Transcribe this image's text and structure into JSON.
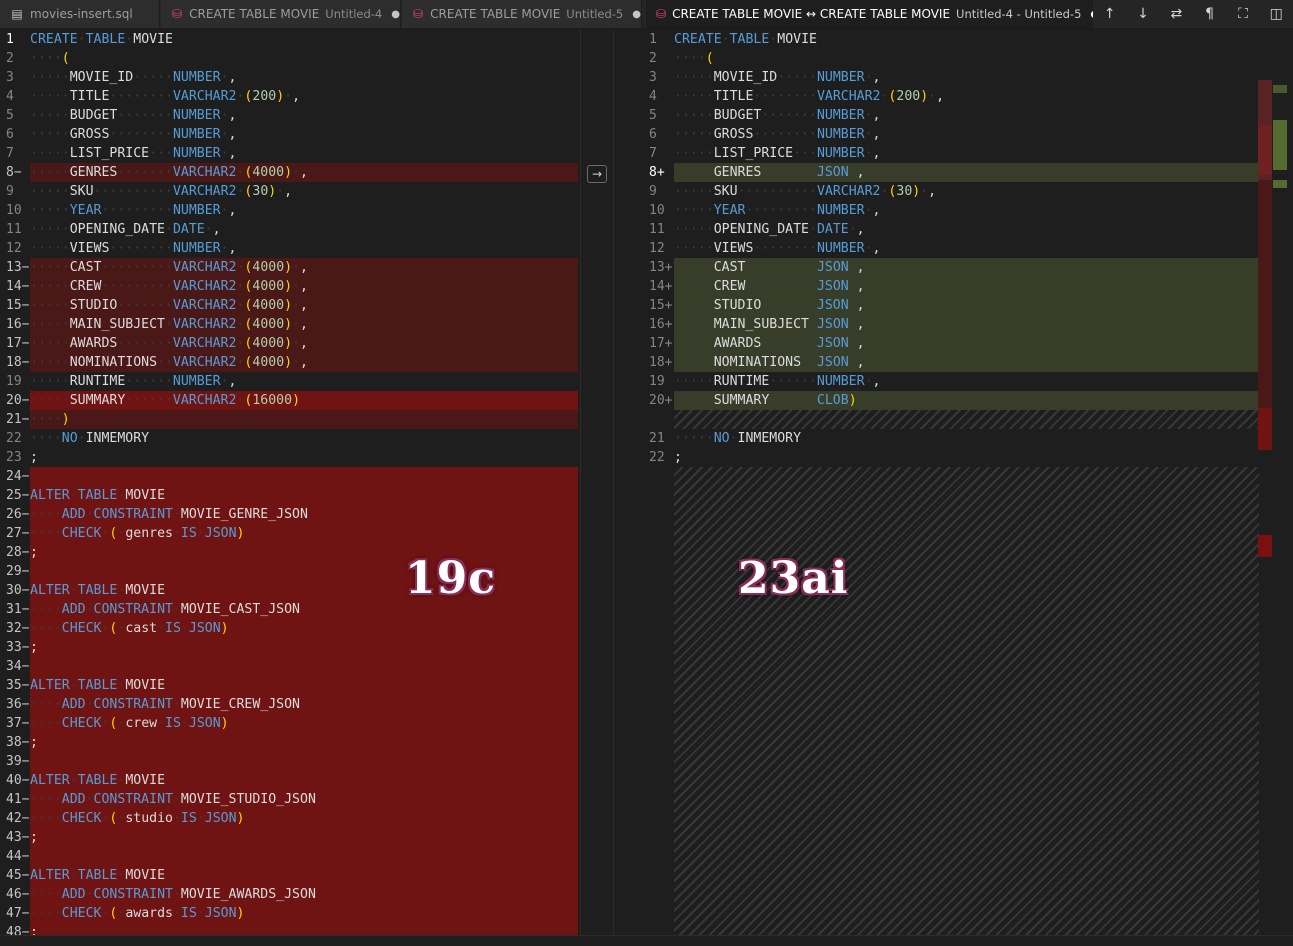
{
  "tabs": [
    {
      "icon": "file-icon",
      "title": "movies-insert.sql",
      "desc": "",
      "dot": false,
      "active": false
    },
    {
      "icon": "database-icon",
      "title": "CREATE TABLE MOVIE",
      "desc": "Untitled-4",
      "dot": true,
      "active": false
    },
    {
      "icon": "database-icon",
      "title": "CREATE TABLE MOVIE",
      "desc": "Untitled-5",
      "dot": true,
      "active": false
    },
    {
      "icon": "database-icon",
      "title": "CREATE TABLE MOVIE ↔ CREATE TABLE MOVIE",
      "desc": "Untitled-4 - Untitled-5",
      "dot": true,
      "active": true
    }
  ],
  "toolbar": {
    "prev_change": "↑",
    "next_change": "↓",
    "swap": "⇄",
    "whitespace": "¶",
    "map": "⛶",
    "split": "◫"
  },
  "overlay_labels": {
    "left": "19c",
    "right": "23ai"
  },
  "left_lines": [
    {
      "n": "1",
      "m": "",
      "hl": "",
      "t": "CREATE TABLE MOVIE"
    },
    {
      "n": "2",
      "m": "",
      "hl": "",
      "t": "    ("
    },
    {
      "n": "3",
      "m": "",
      "hl": "",
      "t": "     MOVIE_ID     NUMBER ,"
    },
    {
      "n": "4",
      "m": "",
      "hl": "",
      "t": "     TITLE        VARCHAR2 (200) ,"
    },
    {
      "n": "5",
      "m": "",
      "hl": "",
      "t": "     BUDGET       NUMBER ,"
    },
    {
      "n": "6",
      "m": "",
      "hl": "",
      "t": "     GROSS        NUMBER ,"
    },
    {
      "n": "7",
      "m": "",
      "hl": "",
      "t": "     LIST_PRICE   NUMBER ,"
    },
    {
      "n": "8",
      "m": "−",
      "hl": "del",
      "t": "     GENRES       VARCHAR2 (4000) ,"
    },
    {
      "n": "9",
      "m": "",
      "hl": "",
      "t": "     SKU          VARCHAR2 (30) ,"
    },
    {
      "n": "10",
      "m": "",
      "hl": "",
      "t": "     YEAR         NUMBER ,"
    },
    {
      "n": "11",
      "m": "",
      "hl": "",
      "t": "     OPENING_DATE DATE ,"
    },
    {
      "n": "12",
      "m": "",
      "hl": "",
      "t": "     VIEWS        NUMBER ,"
    },
    {
      "n": "13",
      "m": "−",
      "hl": "del",
      "t": "     CAST         VARCHAR2 (4000) ,"
    },
    {
      "n": "14",
      "m": "−",
      "hl": "del",
      "t": "     CREW         VARCHAR2 (4000) ,"
    },
    {
      "n": "15",
      "m": "−",
      "hl": "del",
      "t": "     STUDIO       VARCHAR2 (4000) ,"
    },
    {
      "n": "16",
      "m": "−",
      "hl": "del",
      "t": "     MAIN_SUBJECT VARCHAR2 (4000) ,"
    },
    {
      "n": "17",
      "m": "−",
      "hl": "del",
      "t": "     AWARDS       VARCHAR2 (4000) ,"
    },
    {
      "n": "18",
      "m": "−",
      "hl": "del",
      "t": "     NOMINATIONS  VARCHAR2 (4000) ,"
    },
    {
      "n": "19",
      "m": "",
      "hl": "",
      "t": "     RUNTIME      NUMBER ,"
    },
    {
      "n": "20",
      "m": "−",
      "hl": "delstrong",
      "t": "     SUMMARY      VARCHAR2 (16000)"
    },
    {
      "n": "21",
      "m": "−",
      "hl": "del",
      "t": "    )"
    },
    {
      "n": "22",
      "m": "",
      "hl": "",
      "t": "    NO INMEMORY"
    },
    {
      "n": "23",
      "m": "",
      "hl": "",
      "t": ";"
    },
    {
      "n": "24",
      "m": "−",
      "hl": "delstrong",
      "t": ""
    },
    {
      "n": "25",
      "m": "−",
      "hl": "delstrong",
      "t": "ALTER TABLE MOVIE"
    },
    {
      "n": "26",
      "m": "−",
      "hl": "delstrong",
      "t": "    ADD CONSTRAINT MOVIE_GENRE_JSON"
    },
    {
      "n": "27",
      "m": "−",
      "hl": "delstrong",
      "t": "    CHECK ( genres IS JSON)"
    },
    {
      "n": "28",
      "m": "−",
      "hl": "delstrong",
      "t": ";"
    },
    {
      "n": "29",
      "m": "−",
      "hl": "delstrong",
      "t": ""
    },
    {
      "n": "30",
      "m": "−",
      "hl": "delstrong",
      "t": "ALTER TABLE MOVIE"
    },
    {
      "n": "31",
      "m": "−",
      "hl": "delstrong",
      "t": "    ADD CONSTRAINT MOVIE_CAST_JSON"
    },
    {
      "n": "32",
      "m": "−",
      "hl": "delstrong",
      "t": "    CHECK ( cast IS JSON)"
    },
    {
      "n": "33",
      "m": "−",
      "hl": "delstrong",
      "t": ";"
    },
    {
      "n": "34",
      "m": "−",
      "hl": "delstrong",
      "t": ""
    },
    {
      "n": "35",
      "m": "−",
      "hl": "delstrong",
      "t": "ALTER TABLE MOVIE"
    },
    {
      "n": "36",
      "m": "−",
      "hl": "delstrong",
      "t": "    ADD CONSTRAINT MOVIE_CREW_JSON"
    },
    {
      "n": "37",
      "m": "−",
      "hl": "delstrong",
      "t": "    CHECK ( crew IS JSON)"
    },
    {
      "n": "38",
      "m": "−",
      "hl": "delstrong",
      "t": ";"
    },
    {
      "n": "39",
      "m": "−",
      "hl": "delstrong",
      "t": ""
    },
    {
      "n": "40",
      "m": "−",
      "hl": "delstrong",
      "t": "ALTER TABLE MOVIE"
    },
    {
      "n": "41",
      "m": "−",
      "hl": "delstrong",
      "t": "    ADD CONSTRAINT MOVIE_STUDIO_JSON"
    },
    {
      "n": "42",
      "m": "−",
      "hl": "delstrong",
      "t": "    CHECK ( studio IS JSON)"
    },
    {
      "n": "43",
      "m": "−",
      "hl": "delstrong",
      "t": ";"
    },
    {
      "n": "44",
      "m": "−",
      "hl": "delstrong",
      "t": ""
    },
    {
      "n": "45",
      "m": "−",
      "hl": "delstrong",
      "t": "ALTER TABLE MOVIE"
    },
    {
      "n": "46",
      "m": "−",
      "hl": "delstrong",
      "t": "    ADD CONSTRAINT MOVIE_AWARDS_JSON"
    },
    {
      "n": "47",
      "m": "−",
      "hl": "delstrong",
      "t": "    CHECK ( awards IS JSON)"
    },
    {
      "n": "48",
      "m": "−",
      "hl": "delstrong",
      "t": ";"
    }
  ],
  "right_lines": [
    {
      "n": "1",
      "m": "",
      "hl": "",
      "t": "CREATE TABLE MOVIE"
    },
    {
      "n": "2",
      "m": "",
      "hl": "",
      "t": "    ("
    },
    {
      "n": "3",
      "m": "",
      "hl": "",
      "t": "     MOVIE_ID     NUMBER ,"
    },
    {
      "n": "4",
      "m": "",
      "hl": "",
      "t": "     TITLE        VARCHAR2 (200) ,"
    },
    {
      "n": "5",
      "m": "",
      "hl": "",
      "t": "     BUDGET       NUMBER ,"
    },
    {
      "n": "6",
      "m": "",
      "hl": "",
      "t": "     GROSS        NUMBER ,"
    },
    {
      "n": "7",
      "m": "",
      "hl": "",
      "t": "     LIST_PRICE   NUMBER ,"
    },
    {
      "n": "8",
      "m": "+",
      "hl": "ins",
      "t": "     GENRES       JSON ,"
    },
    {
      "n": "9",
      "m": "",
      "hl": "",
      "t": "     SKU          VARCHAR2 (30) ,"
    },
    {
      "n": "10",
      "m": "",
      "hl": "",
      "t": "     YEAR         NUMBER ,"
    },
    {
      "n": "11",
      "m": "",
      "hl": "",
      "t": "     OPENING_DATE DATE ,"
    },
    {
      "n": "12",
      "m": "",
      "hl": "",
      "t": "     VIEWS        NUMBER ,"
    },
    {
      "n": "13",
      "m": "+",
      "hl": "ins",
      "t": "     CAST         JSON ,"
    },
    {
      "n": "14",
      "m": "+",
      "hl": "ins",
      "t": "     CREW         JSON ,"
    },
    {
      "n": "15",
      "m": "+",
      "hl": "ins",
      "t": "     STUDIO       JSON ,"
    },
    {
      "n": "16",
      "m": "+",
      "hl": "ins",
      "t": "     MAIN_SUBJECT JSON ,"
    },
    {
      "n": "17",
      "m": "+",
      "hl": "ins",
      "t": "     AWARDS       JSON ,"
    },
    {
      "n": "18",
      "m": "+",
      "hl": "ins",
      "t": "     NOMINATIONS  JSON ,"
    },
    {
      "n": "19",
      "m": "",
      "hl": "",
      "t": "     RUNTIME      NUMBER ,"
    },
    {
      "n": "20",
      "m": "+",
      "hl": "ins",
      "t": "     SUMMARY      CLOB)"
    },
    {
      "n": "",
      "m": "",
      "hl": "hatch",
      "t": ""
    },
    {
      "n": "21",
      "m": "",
      "hl": "",
      "t": "     NO INMEMORY"
    },
    {
      "n": "22",
      "m": "",
      "hl": "",
      "t": ";"
    }
  ],
  "colors": {
    "deleted_line": "#4b1818",
    "deleted_strong": "#6f1313",
    "inserted_line": "#373d29",
    "keyword": "#569cd6",
    "number": "#b5cea8",
    "paren": "#ffd700"
  }
}
